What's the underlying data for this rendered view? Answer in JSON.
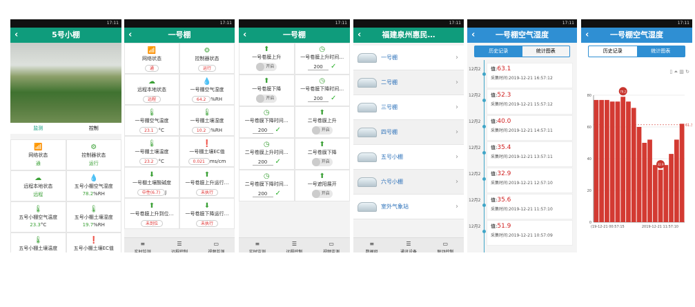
{
  "status_time": "17:11",
  "p1": {
    "title": "5号小棚",
    "tabs": [
      "监测",
      "控制"
    ],
    "cells": [
      {
        "label": "网络状态",
        "value": "通"
      },
      {
        "label": "控制器状态",
        "value": "运行"
      },
      {
        "label": "远程本地状态",
        "value": "远程"
      },
      {
        "label": "五号小棚空气湿度",
        "value": "78.2",
        "unit": "%RH"
      },
      {
        "label": "五号小棚空气温度",
        "value": "23.3",
        "unit": "°C"
      },
      {
        "label": "五号小棚土壤湿度",
        "value": "19.7",
        "unit": "%RH"
      },
      {
        "label": "五号小棚土壤温度",
        "value": ""
      },
      {
        "label": "五号小棚土壤EC值",
        "value": ""
      }
    ]
  },
  "p2": {
    "title": "一号棚",
    "cells": [
      {
        "label": "网络状态",
        "value": "通"
      },
      {
        "label": "控制器状态",
        "value": "运行"
      },
      {
        "label": "远程本地状态",
        "value": "远程"
      },
      {
        "label": "一号棚空气湿度",
        "value": "64.2",
        "unit": "%RH"
      },
      {
        "label": "一号棚空气温度",
        "value": "23.1",
        "unit": "°C"
      },
      {
        "label": "一号棚土壤湿度",
        "value": "10.2",
        "unit": "%RH"
      },
      {
        "label": "一号棚土壤温度",
        "value": "23.2",
        "unit": "°C"
      },
      {
        "label": "一号棚土壤EC值",
        "value": "0.021",
        "unit": "ms/cm"
      },
      {
        "label": "一号棚土壤酸碱度",
        "value": "中性(6.7)",
        "unit": "J"
      },
      {
        "label": "一号卷膜上升运行…",
        "value": "未执行"
      },
      {
        "label": "一号卷膜上升到位…",
        "value": "未到位"
      },
      {
        "label": "一号卷膜下降运行…",
        "value": "未执行"
      }
    ],
    "nav": [
      "实时监测",
      "远程控制",
      "视频监测"
    ]
  },
  "p3": {
    "title": "一号棚",
    "ctrls": [
      {
        "label": "一号卷膜上升",
        "kind": "toggle",
        "btn": "开启"
      },
      {
        "label": "一号卷膜上升时间…",
        "kind": "num",
        "num": "200"
      },
      {
        "label": "一号卷膜下降",
        "kind": "toggle",
        "btn": "开启"
      },
      {
        "label": "一号卷膜下降时间…",
        "kind": "num",
        "num": "200"
      },
      {
        "label": "一号卷膜下降时间…",
        "kind": "num",
        "num": "200"
      },
      {
        "label": "二号卷膜上升",
        "kind": "toggle",
        "btn": "开启"
      },
      {
        "label": "二号卷膜上升时间…",
        "kind": "num",
        "num": "200"
      },
      {
        "label": "二号卷膜下降",
        "kind": "toggle",
        "btn": "开启"
      },
      {
        "label": "二号卷膜下降时间…",
        "kind": "num",
        "num": "200"
      },
      {
        "label": "一号遮阳展开",
        "kind": "toggle",
        "btn": "开启"
      }
    ],
    "nav": [
      "实时监测",
      "远程控制",
      "视频监测"
    ]
  },
  "p4": {
    "title": "福建泉州惠民…",
    "items": [
      "一号棚",
      "二号棚",
      "三号棚",
      "四号棚",
      "五号小棚",
      "六号小棚",
      "室外气象站"
    ],
    "nav": [
      "数据组",
      "通讯设备",
      "联动控制"
    ]
  },
  "p5": {
    "title": "一号棚空气湿度",
    "tabs": [
      "历史记录",
      "统计图表"
    ],
    "date": "12月2",
    "records": [
      {
        "v": "63.1",
        "t": "2019-12-21 16:57:12"
      },
      {
        "v": "52.3",
        "t": "2019-12-21 15:57:12"
      },
      {
        "v": "40.0",
        "t": "2019-12-21 14:57:11"
      },
      {
        "v": "35.4",
        "t": "2019-12-21 13:57:11"
      },
      {
        "v": "32.9",
        "t": "2019-12-21 12:57:10"
      },
      {
        "v": "35.6",
        "t": "2019-12-21 11:57:10"
      },
      {
        "v": "51.9",
        "t": "2019-12-21 10:57:09"
      }
    ],
    "val_prefix": "值:",
    "time_prefix": "采集时间:"
  },
  "p6": {
    "title": "一号棚空气湿度",
    "tabs": [
      "历史记录",
      "统计图表"
    ]
  },
  "chart_data": {
    "type": "bar",
    "values": [
      77,
      77,
      77,
      76,
      76,
      79,
      76,
      72,
      60,
      50,
      52,
      36,
      33,
      36,
      43,
      52,
      62
    ],
    "ylim": [
      0,
      80
    ],
    "yticks": [
      "0",
      "20",
      "40",
      "60",
      "80"
    ],
    "xticks": [
      "(19-12-21 00:57:15",
      "2019-12-21 11:57:10"
    ],
    "annot_max": "79.2",
    "annot_min": "32.9",
    "ref_label": "61.38",
    "bar_color": "#d33a32"
  },
  "colors": {
    "green": "#0f9c7c",
    "blue": "#2f8fd3",
    "red": "#d02020"
  }
}
